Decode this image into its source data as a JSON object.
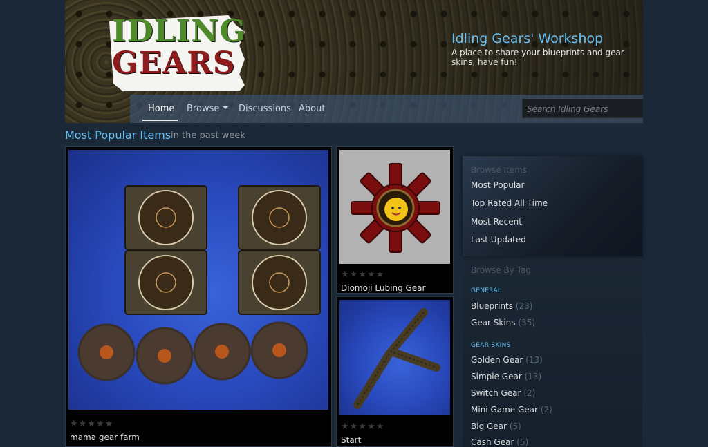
{
  "header": {
    "logo": {
      "line1": "IDLING",
      "line2": "GEARS"
    },
    "title": "Idling Gears' Workshop",
    "subtitle": "A place to share your blueprints and gear skins, have fun!"
  },
  "nav": {
    "items": [
      {
        "label": "Home",
        "active": true
      },
      {
        "label": "Browse",
        "has_dropdown": true
      },
      {
        "label": "Discussions"
      },
      {
        "label": "About"
      }
    ],
    "search": {
      "placeholder": "Search Idling Gears",
      "value": "",
      "icon": "search-icon"
    }
  },
  "section": {
    "title": "Most Popular Items",
    "subtitle": "in the past week"
  },
  "items": [
    {
      "name": "mama gear farm",
      "stars": "★★★★★",
      "rating": 0
    },
    {
      "name": "Diomoji Lubing Gear",
      "stars": "★★★★★",
      "rating": 0
    },
    {
      "name": "Start",
      "stars": "★★★★★",
      "rating": 0
    }
  ],
  "sidebar": {
    "browse_heading": "Browse Items",
    "browse_links": [
      "Most Popular",
      "Top Rated All Time",
      "Most Recent",
      "Last Updated"
    ],
    "tag_heading": "Browse By Tag",
    "categories": [
      {
        "label": "GENERAL",
        "tags": [
          {
            "name": "Blueprints",
            "count": "(23)"
          },
          {
            "name": "Gear Skins",
            "count": "(35)"
          }
        ]
      },
      {
        "label": "GEAR SKINS",
        "tags": [
          {
            "name": "Golden Gear",
            "count": "(13)"
          },
          {
            "name": "Simple Gear",
            "count": "(13)"
          },
          {
            "name": "Switch Gear",
            "count": "(2)"
          },
          {
            "name": "Mini Game Gear",
            "count": "(2)"
          },
          {
            "name": "Big Gear",
            "count": "(5)"
          },
          {
            "name": "Cash Gear",
            "count": "(5)"
          }
        ]
      }
    ]
  },
  "colors": {
    "page_bg": "#1b2838",
    "accent": "#66c0f4",
    "text": "#dcdedf",
    "muted": "#8f98a0"
  }
}
